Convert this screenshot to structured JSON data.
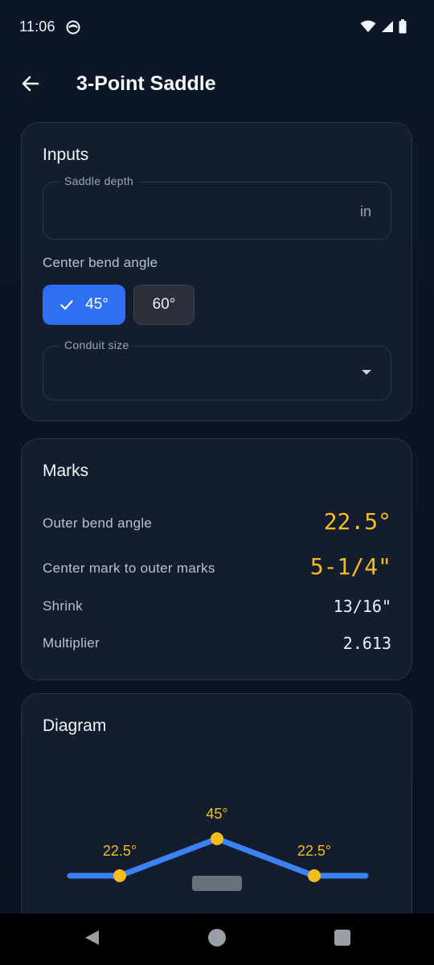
{
  "status_bar": {
    "time": "11:06",
    "icons": [
      "app-notification-icon",
      "wifi-icon",
      "cellular-signal-icon",
      "battery-icon"
    ]
  },
  "app_bar": {
    "back_icon": "arrow-back-icon",
    "title": "3-Point Saddle"
  },
  "inputs": {
    "title": "Inputs",
    "saddle_depth": {
      "label": "Saddle depth",
      "value": "",
      "suffix": "in"
    },
    "center_bend_angle": {
      "label": "Center bend angle",
      "options": [
        "45°",
        "60°"
      ],
      "selected": "45°"
    },
    "conduit_size": {
      "label": "Conduit size",
      "value": ""
    }
  },
  "marks": {
    "title": "Marks",
    "rows": [
      {
        "label": "Outer bend angle",
        "value": "22.5°"
      },
      {
        "label": "Center mark to outer marks",
        "value": "5-1/4\""
      },
      {
        "label": "Shrink",
        "value": "13/16\""
      },
      {
        "label": "Multiplier",
        "value": "2.613"
      }
    ]
  },
  "diagram": {
    "title": "Diagram",
    "left_angle": "22.5°",
    "center_angle": "45°",
    "right_angle": "22.5°"
  },
  "colors": {
    "accent_blue": "#3b82f6",
    "accent_yellow": "#f4bd1c",
    "card_bg": "#141d2e",
    "page_bg": "#0c1422"
  },
  "nav_bar": {
    "buttons": [
      "back-triangle-icon",
      "home-circle-icon",
      "recents-square-icon"
    ]
  }
}
